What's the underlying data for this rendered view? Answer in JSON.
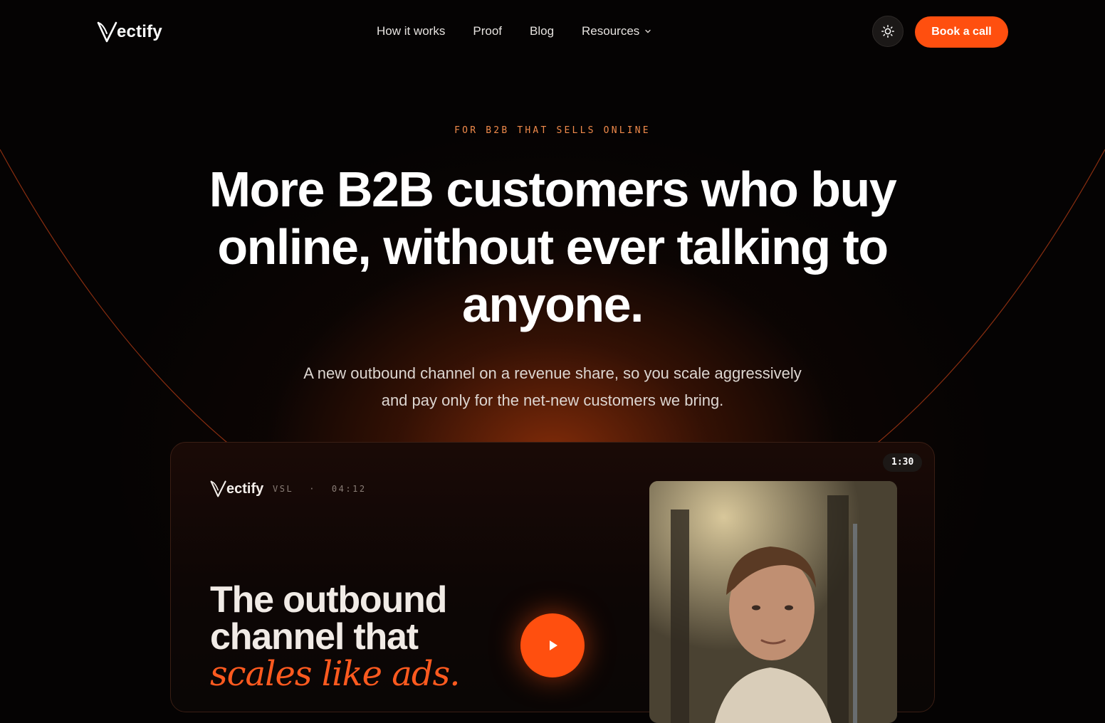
{
  "nav": {
    "brand": "ectify",
    "links": [
      "How it works",
      "Proof",
      "Blog",
      "Resources"
    ],
    "cta": "Book a call"
  },
  "hero": {
    "eyebrow": "FOR B2B THAT SELLS ONLINE",
    "headline_line1": "More B2B customers who buy",
    "headline_line2": "online, without ever talking to",
    "headline_line3": "anyone.",
    "sub_line1": "A new outbound channel on a revenue share, so you scale aggressively",
    "sub_line2": "and pay only for the net-new customers we bring."
  },
  "video": {
    "brand": "ectify",
    "tag": "VSL",
    "separator": "·",
    "duration": "04:12",
    "timer": "1:30",
    "title_line1": "The outbound",
    "title_line2": "channel that",
    "title_accent": "scales like ads."
  },
  "icons": {
    "theme": "sun-icon",
    "dropdown": "chevron-down-icon",
    "play": "play-icon",
    "logo": "v-logo-icon"
  },
  "colors": {
    "accent": "#ff4f0f",
    "eyebrow": "#f08a4b",
    "background": "#050303"
  }
}
